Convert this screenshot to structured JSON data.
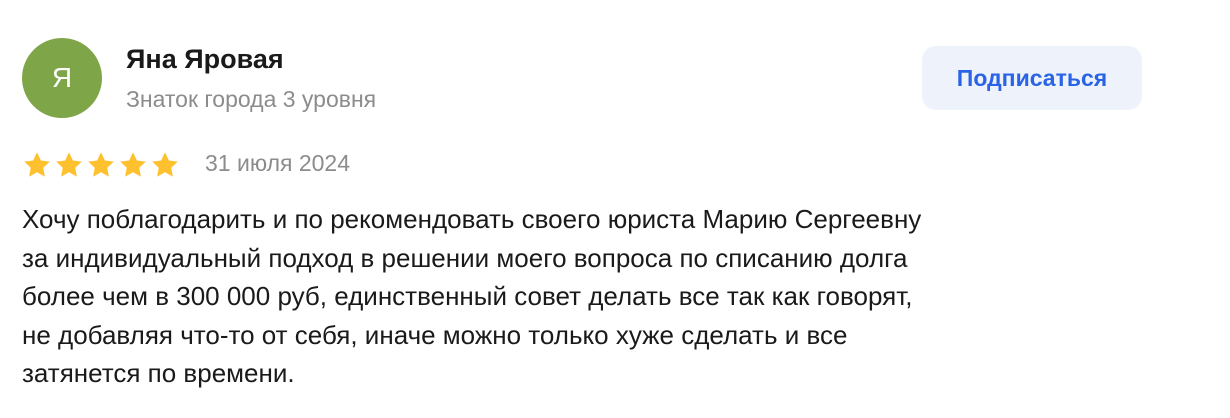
{
  "author": {
    "avatar_initial": "Я",
    "avatar_color": "#7ea548",
    "name": "Яна Яровая",
    "level": "Знаток города 3 уровня"
  },
  "subscribe_label": "Подписаться",
  "review": {
    "rating": 5,
    "max_rating": 5,
    "star_color": "#fdc02f",
    "date": "31 июля 2024",
    "text_lines": [
      "Хочу поблагодарить и по рекомендовать своего юриста Марию Сергеевну",
      "за индивидуальный подход в решении моего вопроса по списанию долга",
      "более чем в 300 000 руб, единственный совет делать все так как говорят,",
      "не добавляя что-то от себя, иначе можно только хуже сделать и все",
      "затянется по времени."
    ]
  },
  "icons": {
    "star": "star-icon"
  },
  "colors": {
    "accent": "#2a64e6",
    "button_bg": "#eef2fb",
    "muted_text": "#8c8c8c"
  }
}
